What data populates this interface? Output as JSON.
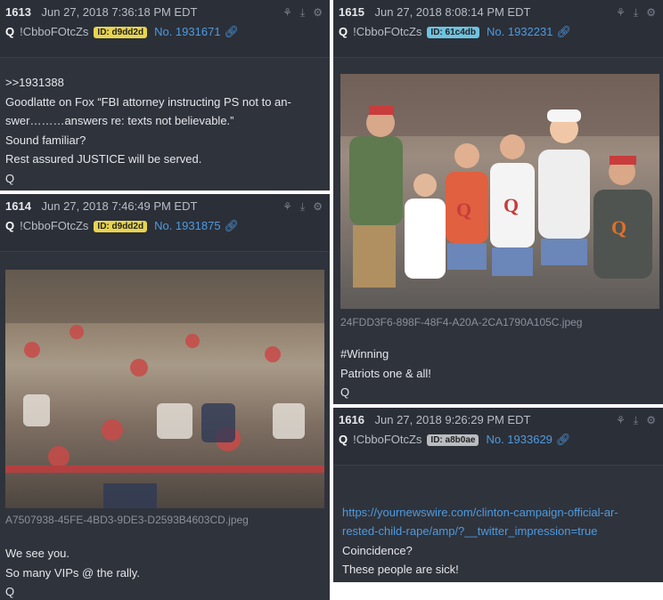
{
  "posts": [
    {
      "number": "1613",
      "date": "Jun 27, 2018 7:36:18 PM EDT",
      "author": "Q",
      "tripcode": "!CbboFOtcZs",
      "id_label": "ID: d9dd2d",
      "id_color": "#e8d44d",
      "post_no": "No. 1931671",
      "text": ">>1931388\nGoodlatte on Fox “FBI attorney instructing PS not to an-\nswer………answers re: texts not believable.”\nSound familiar?\nRest assured JUSTICE will be served.\nQ"
    },
    {
      "number": "1614",
      "date": "Jun 27, 2018 7:46:49 PM EDT",
      "author": "Q",
      "tripcode": "!CbboFOtcZs",
      "id_label": "ID: d9dd2d",
      "id_color": "#e8d44d",
      "post_no": "No. 1931875",
      "image_filename": "A7507938-45FE-4BD3-9DE3-D2593B4603CD.jpeg",
      "text": "We see you.\nSo many VIPs @ the rally.\nQ"
    },
    {
      "number": "1615",
      "date": "Jun 27, 2018 8:08:14 PM EDT",
      "author": "Q",
      "tripcode": "!CbboFOtcZs",
      "id_label": "ID: 61c4db",
      "id_color": "#6fc3e0",
      "post_no": "No. 1932231",
      "image_filename": "24FDD3F6-898F-48F4-A20A-2CA1790A105C.jpeg",
      "text": "#Winning\nPatriots one & all!\nQ"
    },
    {
      "number": "1616",
      "date": "Jun 27, 2018 9:26:29 PM EDT",
      "author": "Q",
      "tripcode": "!CbboFOtcZs",
      "id_label": "ID: a8b0ae",
      "id_color": "#b9bdc0",
      "post_no": "No. 1933629",
      "link": "https://yournewswire.com/clinton-campaign-official-ar-\nrested-child-rape/amp/?__twitter_impression=true",
      "text": "Coincidence?\nThese people are sick!\nQ"
    }
  ],
  "icons": [
    "share-icon",
    "download-icon",
    "settings-icon",
    "permalink-icon"
  ]
}
